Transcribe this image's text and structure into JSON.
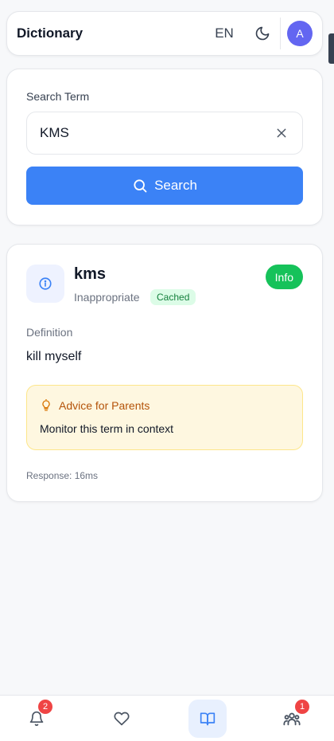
{
  "header": {
    "title": "Dictionary",
    "language": "EN",
    "theme_icon": "moon-icon",
    "avatar_initial": "A",
    "avatar_color": "#6366f1"
  },
  "search": {
    "label": "Search Term",
    "value": "KMS",
    "button_label": "Search",
    "accent": "#3b82f6"
  },
  "result": {
    "term": "kms",
    "category": "Inappropriate",
    "cache_status": "Cached",
    "severity": "Info",
    "definition_label": "Definition",
    "definition": "kill myself",
    "advice": {
      "title": "Advice for Parents",
      "text": "Monitor this term in context"
    },
    "response_time": "Response: 16ms"
  },
  "nav": {
    "items": [
      {
        "name": "notifications",
        "icon": "bell-icon",
        "badge": "2",
        "active": false
      },
      {
        "name": "favorites",
        "icon": "heart-icon",
        "badge": "",
        "active": false
      },
      {
        "name": "dictionary",
        "icon": "book-icon",
        "badge": "",
        "active": true
      },
      {
        "name": "family",
        "icon": "users-icon",
        "badge": "1",
        "active": false
      }
    ]
  }
}
